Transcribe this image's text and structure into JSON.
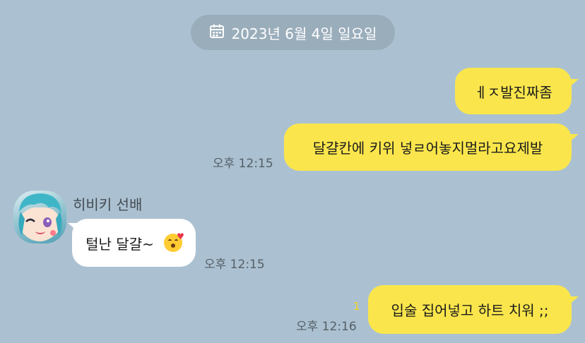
{
  "date_divider": {
    "icon": "calendar-icon",
    "text": "2023년 6월 4일 일요일"
  },
  "messages": [
    {
      "direction": "outgoing",
      "text": "ㅔㅈ발진짜좀"
    },
    {
      "direction": "outgoing",
      "text": "달걀칸에 키위 넣ㄹ어놓지멀라고요제발",
      "time": "오후 12:15"
    },
    {
      "direction": "incoming",
      "sender": "히비키 선배",
      "text": "털난 달걀~",
      "emoji": "kissing-heart-emoji",
      "time": "오후 12:15"
    },
    {
      "direction": "outgoing",
      "text": "입술 집어넣고 하트 치워 ;;",
      "time": "오후 12:16",
      "unread_count": "1"
    }
  ],
  "colors": {
    "background": "#abc1d1",
    "outgoing_bubble": "#fae64c",
    "incoming_bubble": "#ffffff",
    "date_pill": "#9aadbb",
    "unread_count": "#f5d51a"
  }
}
